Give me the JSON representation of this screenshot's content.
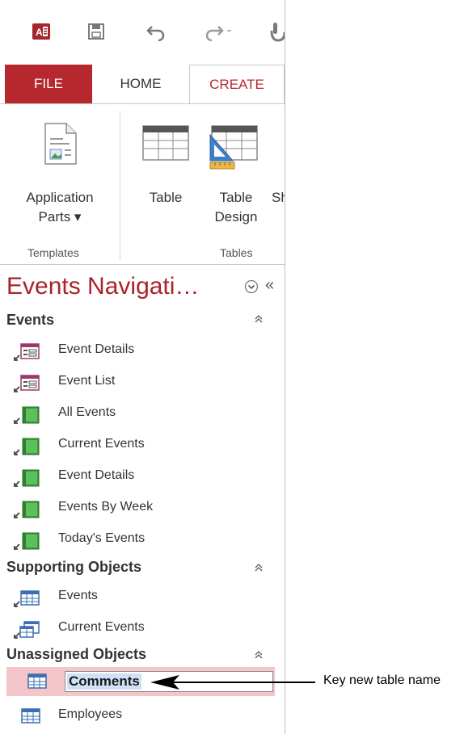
{
  "qat": {
    "app_icon": "access-logo-icon",
    "save_icon": "save-icon",
    "undo_icon": "undo-icon",
    "redo_icon": "redo-icon",
    "touch_icon": "touch-mode-icon"
  },
  "tabs": {
    "file": "FILE",
    "home": "HOME",
    "create": "CREATE"
  },
  "ribbon": {
    "application_parts_line1": "Application",
    "application_parts_line2": "Parts ▾",
    "table": "Table",
    "table_design_line1": "Table",
    "table_design_line2": "Design",
    "sharepoint_partial": "Sh",
    "group_templates": "Templates",
    "group_tables": "Tables"
  },
  "nav": {
    "title": "Events Navigati…",
    "menu_icon": "chevron-down-circle-icon",
    "collapse": "«",
    "groups": [
      {
        "name": "Events",
        "items": [
          {
            "label": "Event Details",
            "icon": "form-icon"
          },
          {
            "label": "Event List",
            "icon": "form-icon"
          },
          {
            "label": "All Events",
            "icon": "report-icon"
          },
          {
            "label": "Current Events",
            "icon": "report-icon"
          },
          {
            "label": "Event Details",
            "icon": "report-icon"
          },
          {
            "label": "Events By Week",
            "icon": "report-icon"
          },
          {
            "label": "Today's Events",
            "icon": "report-icon"
          }
        ]
      },
      {
        "name": "Supporting Objects",
        "items": [
          {
            "label": "Events",
            "icon": "table-icon"
          },
          {
            "label": "Current Events",
            "icon": "query-icon"
          }
        ]
      },
      {
        "name": "Unassigned Objects",
        "items": [
          {
            "label": "Comments",
            "icon": "table-icon",
            "editing": true
          },
          {
            "label": "Employees",
            "icon": "table-icon"
          }
        ]
      }
    ]
  },
  "callout": {
    "text": "Key new table name"
  },
  "colors": {
    "accent": "#b7282e",
    "selection": "#f4c6c9",
    "edit_highlight": "#cfe0f7"
  }
}
